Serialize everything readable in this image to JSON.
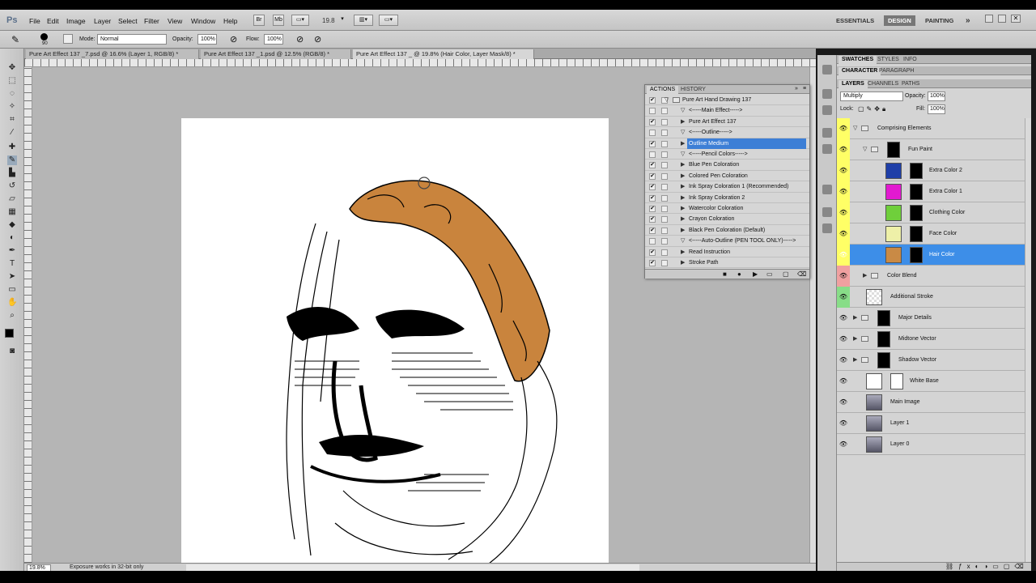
{
  "menubar": {
    "logo": "Ps",
    "items": [
      "File",
      "Edit",
      "Image",
      "Layer",
      "Select",
      "Filter",
      "View",
      "Window",
      "Help"
    ],
    "mini_buttons": [
      "Br",
      "Mb"
    ],
    "zoom": "19.8",
    "workspaces": [
      "ESSENTIALS",
      "DESIGN",
      "PAINTING"
    ],
    "more": "»"
  },
  "options": {
    "brush_size": "90",
    "mode_label": "Mode:",
    "mode_value": "Normal",
    "opacity_label": "Opacity:",
    "opacity_value": "100%",
    "flow_label": "Flow:",
    "flow_value": "100%"
  },
  "doc_tabs": [
    "Pure Art Effect 137 _7.psd @ 16.6% (Layer 1, RGB/8) *",
    "Pure Art Effect 137 _1.psd @ 12.5% (RGB/8) *",
    "Pure Art Effect 137 _ @ 19.8% (Hair Color, Layer Mask/8) *"
  ],
  "status": {
    "zoom": "19.8%",
    "message": "Exposure works in 32-bit only"
  },
  "actions_panel": {
    "tabs": [
      "ACTIONS",
      "HISTORY"
    ],
    "rows": [
      {
        "label": "Pure Art Hand Drawing 137",
        "check": "✔",
        "tri": "▽",
        "folder": true
      },
      {
        "label": "<-----Main Effect----->",
        "check": "",
        "tri": "▽"
      },
      {
        "label": "Pure Art Effect 137",
        "check": "✔",
        "tri": "▶"
      },
      {
        "label": "<-----Outline----->",
        "check": "",
        "tri": "▽"
      },
      {
        "label": "Outline Medium",
        "check": "✔",
        "tri": "▶",
        "selected": true
      },
      {
        "label": "<-----Pencil Colors----->",
        "check": "",
        "tri": "▽"
      },
      {
        "label": "Blue Pen Coloration",
        "check": "✔",
        "tri": "▶"
      },
      {
        "label": "Colored Pen Coloration",
        "check": "✔",
        "tri": "▶"
      },
      {
        "label": "Ink Spray Coloration 1 (Recommended)",
        "check": "✔",
        "tri": "▶"
      },
      {
        "label": "Ink Spray Coloration 2",
        "check": "✔",
        "tri": "▶"
      },
      {
        "label": "Watercolor Coloration",
        "check": "✔",
        "tri": "▶"
      },
      {
        "label": "Crayon Coloration",
        "check": "✔",
        "tri": "▶"
      },
      {
        "label": "Black Pen Coloration (Default)",
        "check": "✔",
        "tri": "▶"
      },
      {
        "label": "<-----Auto-Outline (PEN TOOL ONLY)----->",
        "check": "",
        "tri": "▽"
      },
      {
        "label": "Read Instruction",
        "check": "✔",
        "tri": "▶"
      },
      {
        "label": "Stroke Path",
        "check": "✔",
        "tri": "▶"
      }
    ]
  },
  "right_panel": {
    "tabs_row1": [
      "SWATCHES",
      "STYLES",
      "INFO"
    ],
    "tabs_row2": [
      "CHARACTER",
      "PARAGRAPH"
    ],
    "tabs_row3": [
      "LAYERS",
      "CHANNELS",
      "PATHS"
    ],
    "blend_mode": "Multiply",
    "opacity_label": "Opacity:",
    "opacity_value": "100%",
    "lock_label": "Lock:",
    "fill_label": "Fill:",
    "fill_value": "100%",
    "layers": [
      {
        "name": "Comprising Elements",
        "eye": "yel",
        "indent": 0,
        "type": "group",
        "open": true
      },
      {
        "name": "Fun Paint",
        "eye": "yel",
        "indent": 1,
        "type": "group-mask",
        "open": true
      },
      {
        "name": "Extra Color 2",
        "eye": "yel",
        "indent": 2,
        "type": "color",
        "color": "#1f3fa8"
      },
      {
        "name": "Extra Color 1",
        "eye": "yel",
        "indent": 2,
        "type": "color",
        "color": "#e21ad0"
      },
      {
        "name": "Clothing Color",
        "eye": "yel",
        "indent": 2,
        "type": "color",
        "color": "#6fcf3b"
      },
      {
        "name": "Face Color",
        "eye": "yel",
        "indent": 2,
        "type": "color",
        "color": "#eef0a8"
      },
      {
        "name": "Hair Color",
        "eye": "yel",
        "indent": 2,
        "type": "color",
        "color": "#c98a45",
        "selected": true
      },
      {
        "name": "Color Blend",
        "eye": "red",
        "indent": 1,
        "type": "group",
        "open": false
      },
      {
        "name": "Additional Stroke",
        "eye": "grn",
        "indent": 0,
        "type": "plain"
      },
      {
        "name": "Major Details",
        "eye": "",
        "indent": 0,
        "type": "group-mask",
        "open": false
      },
      {
        "name": "Midtone Vector",
        "eye": "",
        "indent": 0,
        "type": "group-mask",
        "open": false
      },
      {
        "name": "Shadow Vector",
        "eye": "",
        "indent": 0,
        "type": "group-mask",
        "open": false
      },
      {
        "name": "White Base",
        "eye": "",
        "indent": 0,
        "type": "fill"
      },
      {
        "name": "Main Image",
        "eye": "",
        "indent": 0,
        "type": "smart"
      },
      {
        "name": "Layer 1",
        "eye": "",
        "indent": 0,
        "type": "photo"
      },
      {
        "name": "Layer 0",
        "eye": "",
        "indent": 0,
        "type": "photo"
      }
    ]
  },
  "colors": {
    "hair": "#c9843d",
    "selection": "#3d8ee8",
    "canvas_bg": "#b5b5b5"
  }
}
